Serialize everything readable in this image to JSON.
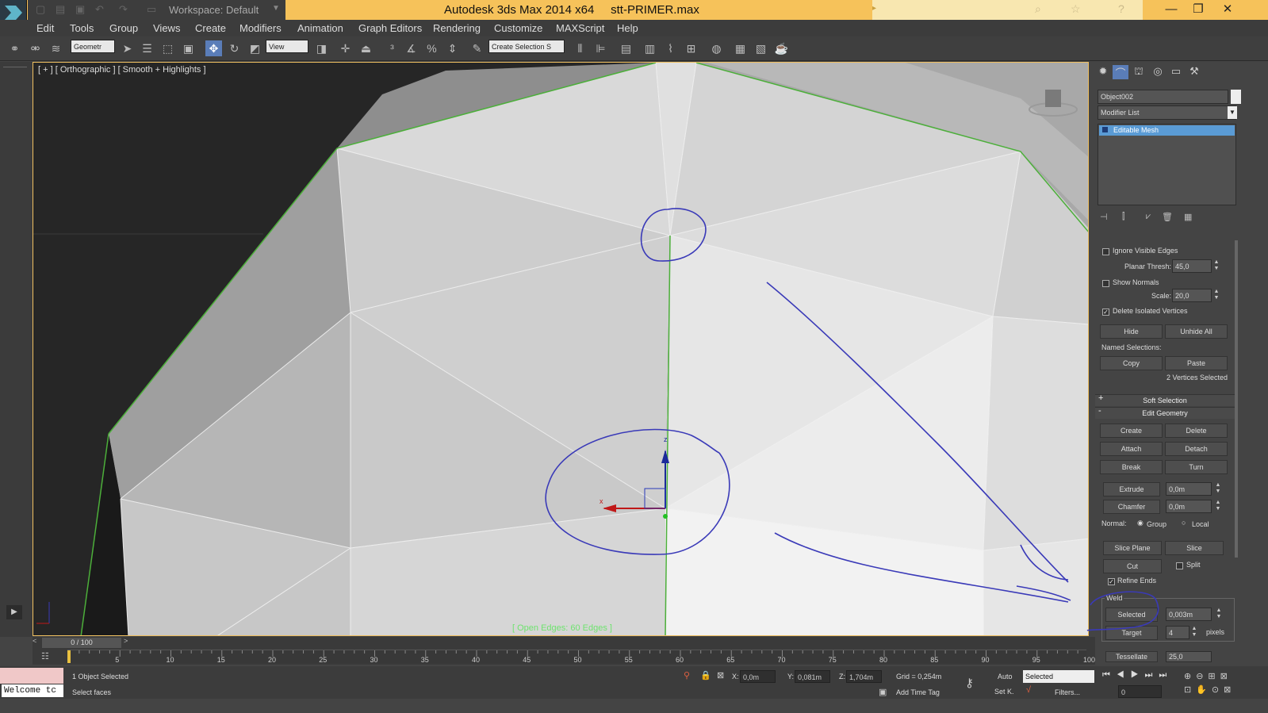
{
  "app": {
    "title": "Autodesk 3ds Max  2014 x64",
    "filename": "stt-PRIMER.max",
    "workspace": "Workspace: Default"
  },
  "menu": [
    "Edit",
    "Tools",
    "Group",
    "Views",
    "Create",
    "Modifiers",
    "Animation",
    "Graph Editors",
    "Rendering",
    "Customize",
    "MAXScript",
    "Help"
  ],
  "toolbar": {
    "selection_filter": "Geometr",
    "ref_coord": "View",
    "named_selection": "Create Selection S"
  },
  "viewport": {
    "label": "[ + ] [ Orthographic ] [ Smooth + Highlights ]",
    "status": "[ Open Edges: 60 Edges ]",
    "gizmo_x": "x",
    "gizmo_z": "z"
  },
  "panel": {
    "object_name": "Object002",
    "modifier_list": "Modifier List",
    "stack_item": "Editable Mesh",
    "ignore_visible_edges": "Ignore Visible Edges",
    "planar_thresh_label": "Planar Thresh:",
    "planar_thresh": "45,0",
    "show_normals": "Show Normals",
    "scale_label": "Scale:",
    "scale": "20,0",
    "delete_isolated": "Delete Isolated Vertices",
    "hide": "Hide",
    "unhide_all": "Unhide All",
    "named_selections": "Named Selections:",
    "copy": "Copy",
    "paste": "Paste",
    "vertices_selected": "2 Vertices Selected",
    "soft_selection": "Soft Selection",
    "edit_geometry": "Edit Geometry",
    "create": "Create",
    "delete": "Delete",
    "attach": "Attach",
    "detach": "Detach",
    "break": "Break",
    "turn": "Turn",
    "extrude": "Extrude",
    "extrude_val": "0,0m",
    "chamfer": "Chamfer",
    "chamfer_val": "0,0m",
    "normal_label": "Normal:",
    "group": "Group",
    "local": "Local",
    "slice_plane": "Slice Plane",
    "slice": "Slice",
    "cut": "Cut",
    "split": "Split",
    "refine_ends": "Refine Ends",
    "weld": "Weld",
    "selected": "Selected",
    "weld_val": "0,003m",
    "target": "Target",
    "target_val": "4",
    "pixels": "pixels",
    "tessellate": "Tessellate",
    "tessellate_val": "25,0"
  },
  "timeline": {
    "frame": "0 / 100",
    "ticks": [
      "5",
      "10",
      "15",
      "20",
      "25",
      "30",
      "35",
      "40",
      "45",
      "50",
      "55",
      "60",
      "65",
      "70",
      "75",
      "80",
      "85",
      "90",
      "95",
      "100"
    ]
  },
  "status": {
    "welcome": "Welcome tc",
    "objects_selected": "1 Object Selected",
    "prompt": "Select faces",
    "x_label": "X:",
    "x": "0,0m",
    "y_label": "Y:",
    "y": "0,081m",
    "z_label": "Z:",
    "z": "1,704m",
    "grid": "Grid = 0,254m",
    "add_time_tag": "Add Time Tag",
    "auto": "Auto",
    "set_key": "Set K.",
    "key_mode": "Selected",
    "filters": "Filters...",
    "frame_field": "0"
  }
}
